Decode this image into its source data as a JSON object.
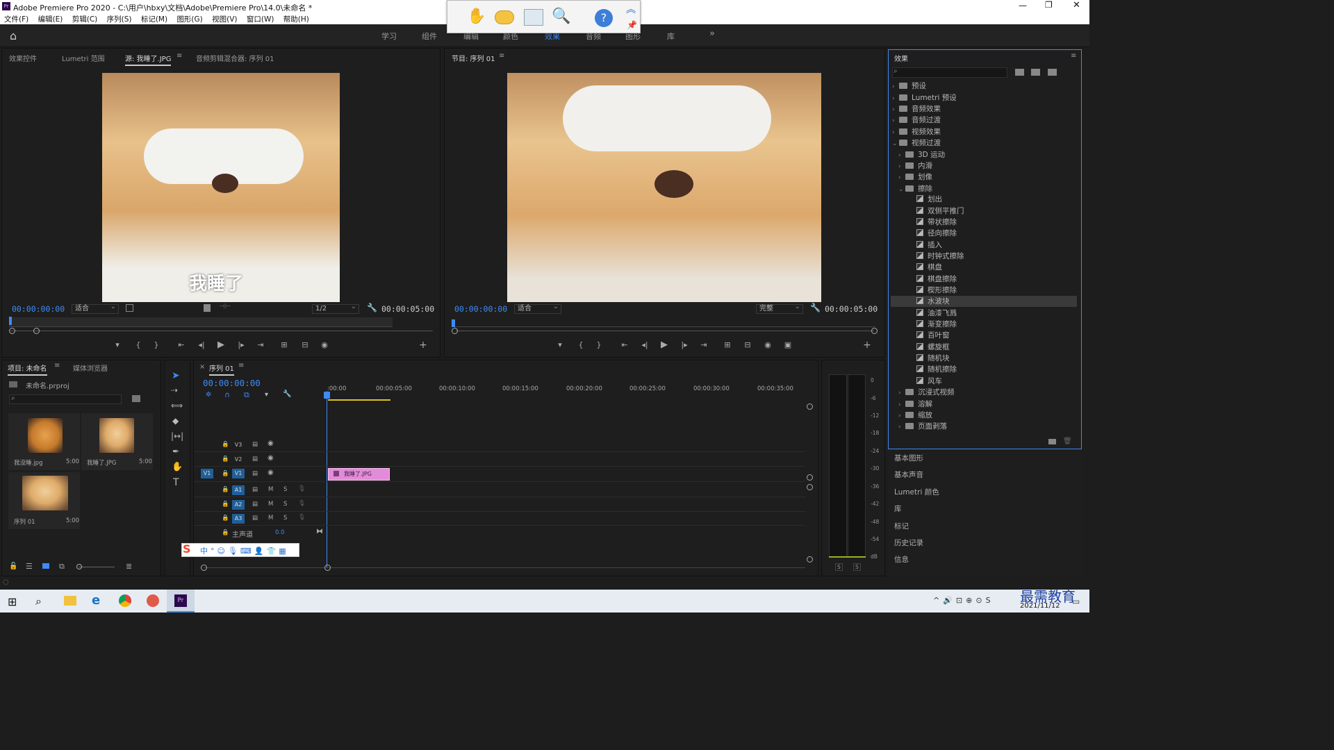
{
  "window": {
    "title": "Adobe Premiere Pro 2020 - C:\\用户\\hbxy\\文档\\Adobe\\Premiere Pro\\14.0\\未命名 *"
  },
  "menu": [
    "文件(F)",
    "编辑(E)",
    "剪辑(C)",
    "序列(S)",
    "标记(M)",
    "图形(G)",
    "视图(V)",
    "窗口(W)",
    "帮助(H)"
  ],
  "workspaces": [
    "学习",
    "组件",
    "编辑",
    "颜色",
    "效果",
    "音频",
    "图形",
    "库"
  ],
  "source_panel": {
    "tabs": [
      "效果控件",
      "Lumetri 范围",
      "源: 我睡了.JPG",
      "音频剪辑混合器: 序列 01"
    ],
    "caption": "我睡了",
    "timecode_in": "00:00:00:00",
    "fit": "适合",
    "resolution": "1/2",
    "duration": "00:00:05:00"
  },
  "program_panel": {
    "tab": "节目: 序列 01",
    "timecode_in": "00:00:00:00",
    "fit": "适合",
    "quality": "完整",
    "duration": "00:00:05:00"
  },
  "project_panel": {
    "tabs": [
      "项目: 未命名",
      "媒体浏览器"
    ],
    "project_file": "未命名.prproj",
    "items": [
      {
        "name": "我没睡.jpg",
        "duration": "5:00"
      },
      {
        "name": "我睡了.JPG",
        "duration": "5:00"
      },
      {
        "name": "序列 01",
        "duration": "5:00"
      }
    ]
  },
  "timeline": {
    "tab": "序列 01",
    "timecode": "00:00:00:00",
    "ruler": [
      ":00:00",
      "00:00:05:00",
      "00:00:10:00",
      "00:00:15:00",
      "00:00:20:00",
      "00:00:25:00",
      "00:00:30:00",
      "00:00:35:00"
    ],
    "video_tracks": [
      "V3",
      "V2",
      "V1"
    ],
    "audio_tracks": [
      "A1",
      "A2",
      "A3"
    ],
    "source_patch_v": "V1",
    "master": {
      "label": "主声道",
      "value": "0.0"
    },
    "clip": {
      "name": "我睡了.JPG"
    },
    "mute_label": "M",
    "solo_label": "S"
  },
  "meter": {
    "ticks": [
      "0",
      "-6",
      "-12",
      "-18",
      "-24",
      "-30",
      "-36",
      "-42",
      "-48",
      "-54",
      "dB"
    ],
    "solo": [
      "S",
      "S"
    ]
  },
  "effects_panel": {
    "title": "效果",
    "tree": [
      {
        "label": "预设",
        "kind": "preset",
        "level": 0
      },
      {
        "label": "Lumetri 预设",
        "kind": "preset",
        "level": 0
      },
      {
        "label": "音频效果",
        "kind": "folder",
        "level": 0
      },
      {
        "label": "音频过渡",
        "kind": "folder",
        "level": 0
      },
      {
        "label": "视频效果",
        "kind": "folder",
        "level": 0
      },
      {
        "label": "视频过渡",
        "kind": "folder",
        "level": 0,
        "open": true
      },
      {
        "label": "3D 运动",
        "kind": "folder",
        "level": 1
      },
      {
        "label": "内滑",
        "kind": "folder",
        "level": 1
      },
      {
        "label": "划像",
        "kind": "folder",
        "level": 1
      },
      {
        "label": "擦除",
        "kind": "folder",
        "level": 1,
        "open": true
      },
      {
        "label": "划出",
        "kind": "fx",
        "level": 2
      },
      {
        "label": "双侧平推门",
        "kind": "fx",
        "level": 2
      },
      {
        "label": "带状擦除",
        "kind": "fx",
        "level": 2
      },
      {
        "label": "径向擦除",
        "kind": "fx",
        "level": 2
      },
      {
        "label": "插入",
        "kind": "fx",
        "level": 2
      },
      {
        "label": "时钟式擦除",
        "kind": "fx",
        "level": 2
      },
      {
        "label": "棋盘",
        "kind": "fx",
        "level": 2
      },
      {
        "label": "棋盘擦除",
        "kind": "fx",
        "level": 2
      },
      {
        "label": "楔形擦除",
        "kind": "fx",
        "level": 2
      },
      {
        "label": "水波块",
        "kind": "fx",
        "level": 2,
        "selected": true
      },
      {
        "label": "油漆飞溅",
        "kind": "fx",
        "level": 2
      },
      {
        "label": "渐变擦除",
        "kind": "fx",
        "level": 2
      },
      {
        "label": "百叶窗",
        "kind": "fx",
        "level": 2
      },
      {
        "label": "螺旋框",
        "kind": "fx",
        "level": 2
      },
      {
        "label": "随机块",
        "kind": "fx",
        "level": 2
      },
      {
        "label": "随机擦除",
        "kind": "fx",
        "level": 2
      },
      {
        "label": "风车",
        "kind": "fx",
        "level": 2
      },
      {
        "label": "沉浸式视频",
        "kind": "folder",
        "level": 1
      },
      {
        "label": "溶解",
        "kind": "folder",
        "level": 1
      },
      {
        "label": "缩放",
        "kind": "folder",
        "level": 1
      },
      {
        "label": "页面剥落",
        "kind": "folder",
        "level": 1
      }
    ],
    "side_panels": [
      "基本图形",
      "基本声音",
      "Lumetri 颜色",
      "库",
      "标记",
      "历史记录",
      "信息"
    ]
  },
  "taskbar": {
    "date": "2021/11/12",
    "watermark": "最需教育"
  },
  "colors": {
    "accent": "#3d8bf7",
    "clip": "#e28bd8",
    "playhead": "#3d8bf7"
  }
}
